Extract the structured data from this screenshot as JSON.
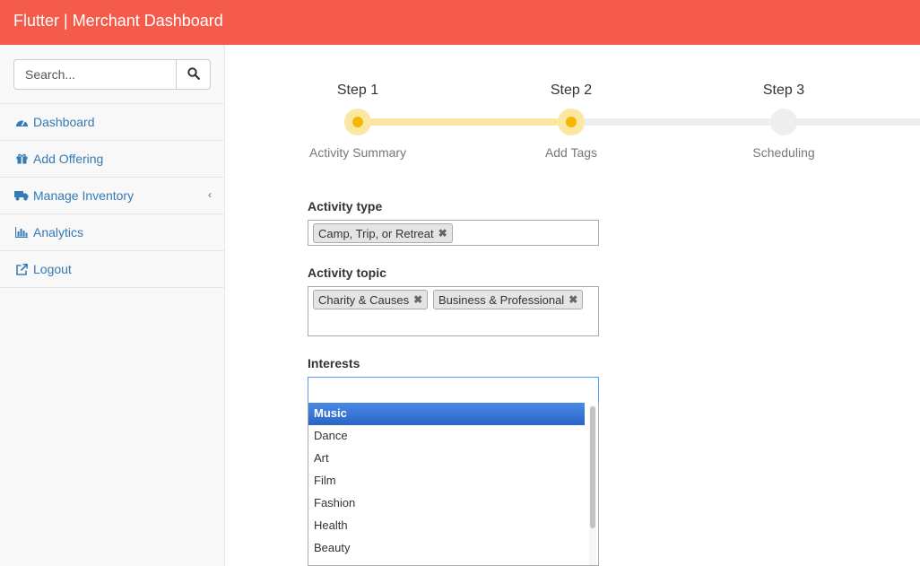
{
  "app": {
    "title": "Flutter | Merchant Dashboard"
  },
  "sidebar": {
    "search_placeholder": "Search...",
    "items": [
      {
        "label": "Dashboard",
        "icon": "tachometer-icon"
      },
      {
        "label": "Add Offering",
        "icon": "gift-icon"
      },
      {
        "label": "Manage Inventory",
        "icon": "truck-icon"
      },
      {
        "label": "Analytics",
        "icon": "bar-chart-icon"
      },
      {
        "label": "Logout",
        "icon": "external-link-icon"
      }
    ]
  },
  "steps": [
    {
      "title": "Step 1",
      "subtitle": "Activity Summary",
      "state": "done"
    },
    {
      "title": "Step 2",
      "subtitle": "Add Tags",
      "state": "current"
    },
    {
      "title": "Step 3",
      "subtitle": "Scheduling",
      "state": "pending"
    }
  ],
  "form": {
    "activity_type": {
      "label": "Activity type",
      "tags": [
        "Camp, Trip, or Retreat"
      ]
    },
    "activity_topic": {
      "label": "Activity topic",
      "tags": [
        "Charity & Causes",
        "Business & Professional"
      ]
    },
    "interests": {
      "label": "Interests",
      "value": "",
      "options": [
        "Music",
        "Dance",
        "Art",
        "Film",
        "Fashion",
        "Health",
        "Beauty"
      ],
      "highlighted": "Music"
    }
  },
  "colors": {
    "brand": "#f55b4a",
    "link": "#337ab7",
    "step_active": "#f5b800",
    "step_track": "#fbe6a2",
    "highlight": "#3875d7"
  }
}
